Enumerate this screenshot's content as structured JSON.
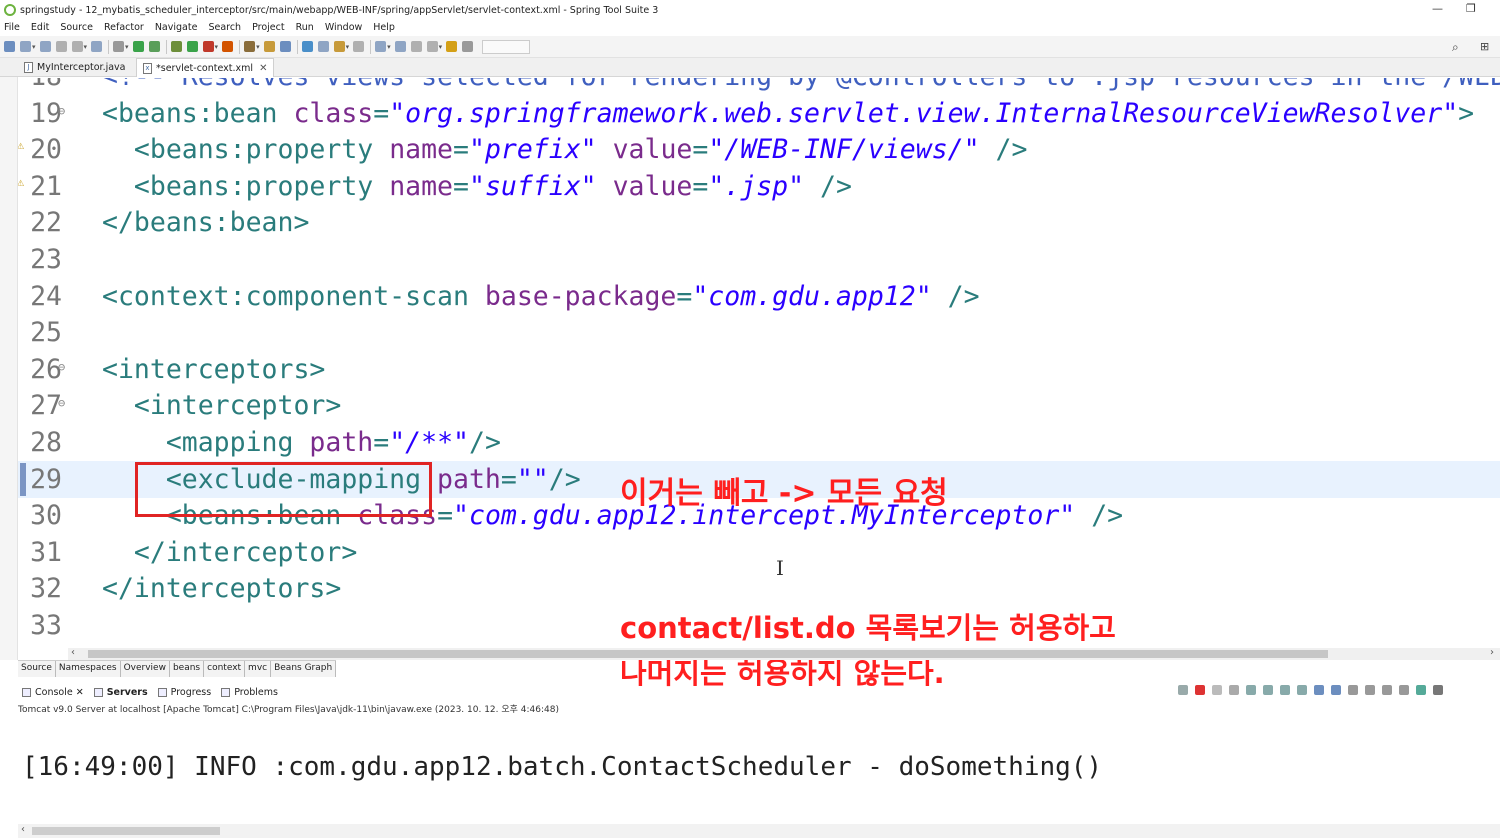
{
  "window": {
    "title": "springstudy - 12_mybatis_scheduler_interceptor/src/main/webapp/WEB-INF/spring/appServlet/servlet-context.xml - Spring Tool Suite 3"
  },
  "menu": [
    "File",
    "Edit",
    "Source",
    "Refactor",
    "Navigate",
    "Search",
    "Project",
    "Run",
    "Window",
    "Help"
  ],
  "tabs": [
    {
      "label": "MyInterceptor.java",
      "active": false
    },
    {
      "label": "*servlet-context.xml",
      "active": true
    }
  ],
  "editor": {
    "lines": [
      {
        "num": "18",
        "fold": "",
        "warn": false,
        "current": false,
        "parts": [
          [
            "cmt",
            "<!-- Resolves views selected for rendering by @Controllers to .jsp resources in the /WEB"
          ]
        ]
      },
      {
        "num": "19",
        "fold": "⊖",
        "warn": false,
        "current": false,
        "parts": [
          [
            "tag",
            "<beans:bean "
          ],
          [
            "attr",
            "class"
          ],
          [
            "tag",
            "="
          ],
          [
            "val",
            "\"org.springframework.web.servlet.view.InternalResourceViewResolver\""
          ],
          [
            "tag",
            ">"
          ]
        ]
      },
      {
        "num": "20",
        "fold": "",
        "warn": true,
        "current": false,
        "parts": [
          [
            "tag",
            "  <beans:property "
          ],
          [
            "attr",
            "name"
          ],
          [
            "tag",
            "="
          ],
          [
            "val",
            "\"prefix\""
          ],
          [
            "tag",
            " "
          ],
          [
            "attr",
            "value"
          ],
          [
            "tag",
            "="
          ],
          [
            "val",
            "\"/WEB-INF/views/\""
          ],
          [
            "tag",
            " />"
          ]
        ]
      },
      {
        "num": "21",
        "fold": "",
        "warn": true,
        "current": false,
        "parts": [
          [
            "tag",
            "  <beans:property "
          ],
          [
            "attr",
            "name"
          ],
          [
            "tag",
            "="
          ],
          [
            "val",
            "\"suffix\""
          ],
          [
            "tag",
            " "
          ],
          [
            "attr",
            "value"
          ],
          [
            "tag",
            "="
          ],
          [
            "val",
            "\".jsp\""
          ],
          [
            "tag",
            " />"
          ]
        ]
      },
      {
        "num": "22",
        "fold": "",
        "warn": false,
        "current": false,
        "parts": [
          [
            "tag",
            "</beans:bean>"
          ]
        ]
      },
      {
        "num": "23",
        "fold": "",
        "warn": false,
        "current": false,
        "parts": []
      },
      {
        "num": "24",
        "fold": "",
        "warn": false,
        "current": false,
        "parts": [
          [
            "tag",
            "<context:component-scan "
          ],
          [
            "attr",
            "base-package"
          ],
          [
            "tag",
            "="
          ],
          [
            "val",
            "\"com.gdu.app12\""
          ],
          [
            "tag",
            " />"
          ]
        ]
      },
      {
        "num": "25",
        "fold": "",
        "warn": false,
        "current": false,
        "parts": []
      },
      {
        "num": "26",
        "fold": "⊖",
        "warn": false,
        "current": false,
        "parts": [
          [
            "tag",
            "<interceptors>"
          ]
        ]
      },
      {
        "num": "27",
        "fold": "⊖",
        "warn": false,
        "current": false,
        "parts": [
          [
            "tag",
            "  <interceptor>"
          ]
        ]
      },
      {
        "num": "28",
        "fold": "",
        "warn": false,
        "current": false,
        "parts": [
          [
            "tag",
            "    <mapping "
          ],
          [
            "attr",
            "path"
          ],
          [
            "tag",
            "="
          ],
          [
            "val",
            "\"/**\""
          ],
          [
            "tag",
            "/>"
          ]
        ]
      },
      {
        "num": "29",
        "fold": "",
        "warn": false,
        "current": true,
        "parts": [
          [
            "tag",
            "    <exclude-mapping "
          ],
          [
            "attr",
            "path"
          ],
          [
            "tag",
            "="
          ],
          [
            "val",
            "\"\""
          ],
          [
            "tag",
            "/>"
          ]
        ]
      },
      {
        "num": "30",
        "fold": "",
        "warn": false,
        "current": false,
        "parts": [
          [
            "tag",
            "    <beans:bean "
          ],
          [
            "attr",
            "class"
          ],
          [
            "tag",
            "="
          ],
          [
            "val",
            "\"com.gdu.app12.intercept.MyInterceptor\""
          ],
          [
            "tag",
            " />"
          ]
        ]
      },
      {
        "num": "31",
        "fold": "",
        "warn": false,
        "current": false,
        "parts": [
          [
            "tag",
            "  </interceptor>"
          ]
        ]
      },
      {
        "num": "32",
        "fold": "",
        "warn": false,
        "current": false,
        "parts": [
          [
            "tag",
            "</interceptors>"
          ]
        ]
      },
      {
        "num": "33",
        "fold": "",
        "warn": false,
        "current": false,
        "parts": []
      }
    ]
  },
  "annotations": {
    "note1": "이거는 빼고 -> 모든 요청",
    "note2": "contact/list.do 목록보기는 허용하고",
    "note3": "나머지는 허용하지 않는다."
  },
  "editor_tabs": [
    "Source",
    "Namespaces",
    "Overview",
    "beans",
    "context",
    "mvc",
    "Beans Graph"
  ],
  "view_tabs": [
    {
      "label": "Console",
      "bold": false,
      "close": true
    },
    {
      "label": "Servers",
      "bold": true,
      "close": false
    },
    {
      "label": "Progress",
      "bold": false,
      "close": false
    },
    {
      "label": "Problems",
      "bold": false,
      "close": false
    }
  ],
  "console": {
    "description": "Tomcat v9.0 Server at localhost [Apache Tomcat] C:\\Program Files\\Java\\jdk-11\\bin\\javaw.exe  (2023. 10. 12. 오후 4:46:48)",
    "output": "[16:49:00] INFO :com.gdu.app12.batch.ContactScheduler - doSomething()"
  },
  "colors": {
    "accent_red": "#ff1f1f",
    "tag": "#2a7c7c",
    "attr": "#7a2b8c",
    "value": "#2a00ff",
    "current_line": "#e8f2fe"
  }
}
